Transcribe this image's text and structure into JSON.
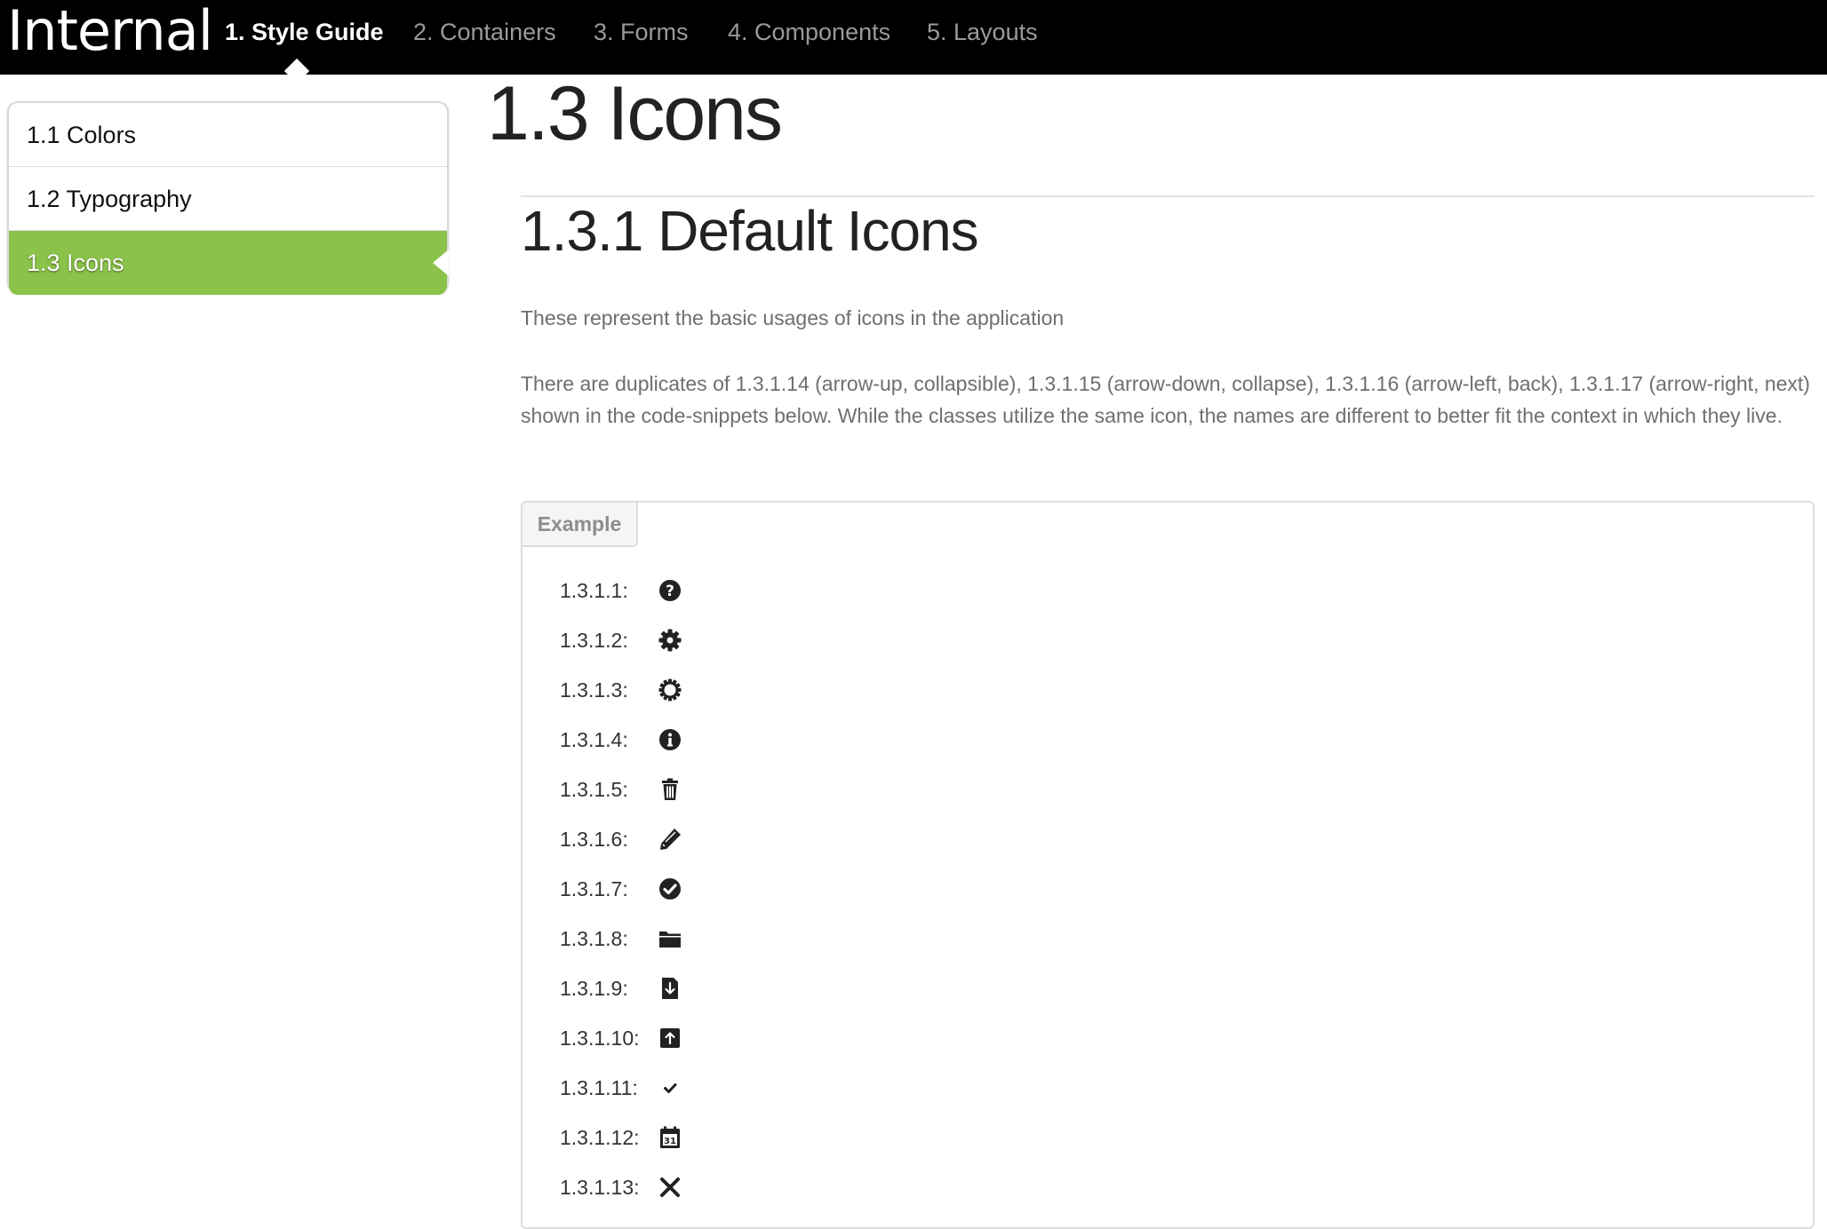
{
  "header": {
    "brand": "Internal",
    "nav": [
      {
        "label": "1. Style Guide",
        "active": true
      },
      {
        "label": "2. Containers",
        "active": false
      },
      {
        "label": "3. Forms",
        "active": false
      },
      {
        "label": "4. Components",
        "active": false
      },
      {
        "label": "5. Layouts",
        "active": false
      }
    ]
  },
  "sidebar": {
    "items": [
      {
        "label": "1.1 Colors",
        "active": false
      },
      {
        "label": "1.2 Typography",
        "active": false
      },
      {
        "label": "1.3 Icons",
        "active": true
      }
    ]
  },
  "main": {
    "title": "1.3 Icons",
    "section_title": "1.3.1 Default Icons",
    "intro": "These represent the basic usages of icons in the application",
    "note": "There are duplicates of 1.3.1.14 (arrow-up, collapsible), 1.3.1.15 (arrow-down, collapse), 1.3.1.16 (arrow-left, back), 1.3.1.17 (arrow-right, next) shown in the code-snippets below. While the classes utilize the same icon, the names are different to better fit the context in which they live.",
    "example": {
      "tab_label": "Example",
      "icons": [
        {
          "label": "1.3.1.1:",
          "icon": "question-circle-icon"
        },
        {
          "label": "1.3.1.2:",
          "icon": "gear-icon"
        },
        {
          "label": "1.3.1.3:",
          "icon": "spinner-gear-icon"
        },
        {
          "label": "1.3.1.4:",
          "icon": "info-circle-icon"
        },
        {
          "label": "1.3.1.5:",
          "icon": "trash-icon"
        },
        {
          "label": "1.3.1.6:",
          "icon": "pencil-icon"
        },
        {
          "label": "1.3.1.7:",
          "icon": "check-circle-icon"
        },
        {
          "label": "1.3.1.8:",
          "icon": "folder-icon"
        },
        {
          "label": "1.3.1.9:",
          "icon": "file-download-icon"
        },
        {
          "label": "1.3.1.10:",
          "icon": "upload-box-icon"
        },
        {
          "label": "1.3.1.11:",
          "icon": "checkmark-icon"
        },
        {
          "label": "1.3.1.12:",
          "icon": "calendar-icon"
        },
        {
          "label": "1.3.1.13:",
          "icon": "close-x-icon"
        }
      ]
    }
  },
  "colors": {
    "accent": "#8bc34a",
    "topbar": "#000000",
    "nav_inactive": "#9a9a9a",
    "paragraph": "#6f6f6f",
    "icon": "#222222"
  }
}
